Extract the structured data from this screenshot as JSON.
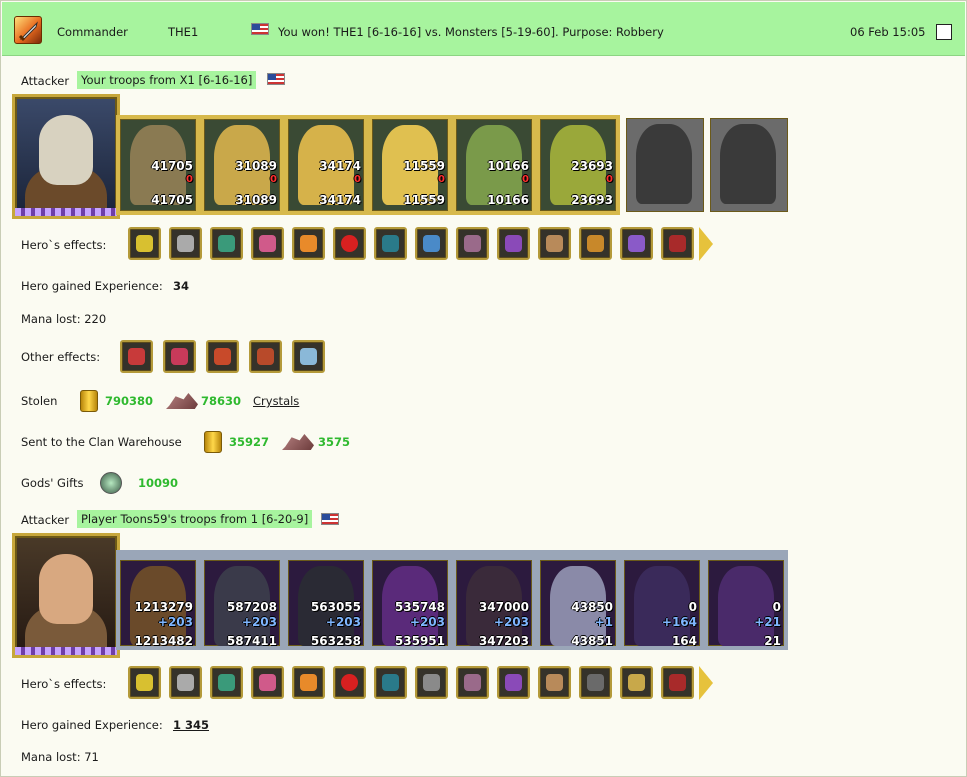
{
  "header": {
    "role": "Commander",
    "player": "THE1",
    "message": "You won! THE1 [6-16-16] vs. Monsters [5-19-60]. Purpose: Robbery",
    "datetime": "06 Feb 15:05"
  },
  "attacker1": {
    "label": "Attacker",
    "tag": "Your troops from X1 [6-16-16]",
    "troops": [
      {
        "top": "41705",
        "loss": "0",
        "bottom": "41705"
      },
      {
        "top": "31089",
        "loss": "0",
        "bottom": "31089"
      },
      {
        "top": "34174",
        "loss": "0",
        "bottom": "34174"
      },
      {
        "top": "11559",
        "loss": "0",
        "bottom": "11559"
      },
      {
        "top": "10166",
        "loss": "0",
        "bottom": "10166"
      },
      {
        "top": "23693",
        "loss": "0",
        "bottom": "23693"
      }
    ],
    "effects_label": "Hero`s effects:",
    "exp_label": "Hero gained Experience:",
    "exp_value": "34",
    "mana_label": "Mana lost: 220",
    "other_label": "Other effects:",
    "stolen_label": "Stolen",
    "stolen_gold": "790380",
    "stolen_ore": "78630",
    "stolen_link": "Crystals",
    "warehouse_label": "Sent to the Clan Warehouse",
    "warehouse_gold": "35927",
    "warehouse_ore": "3575",
    "gods_label": "Gods' Gifts",
    "gods_value": "10090"
  },
  "attacker2": {
    "label": "Attacker",
    "tag": "Player Toons59's troops from 1 [6-20-9]",
    "troops": [
      {
        "top": "1213279",
        "gain": "+203",
        "bottom": "1213482"
      },
      {
        "top": "587208",
        "gain": "+203",
        "bottom": "587411"
      },
      {
        "top": "563055",
        "gain": "+203",
        "bottom": "563258"
      },
      {
        "top": "535748",
        "gain": "+203",
        "bottom": "535951"
      },
      {
        "top": "347000",
        "gain": "+203",
        "bottom": "347203"
      },
      {
        "top": "43850",
        "gain": "+1",
        "bottom": "43851"
      },
      {
        "top": "0",
        "gain": "+164",
        "bottom": "164"
      },
      {
        "top": "0",
        "gain": "+21",
        "bottom": "21"
      }
    ],
    "effects_label": "Hero`s effects:",
    "exp_label": "Hero gained Experience:",
    "exp_value": "1 345",
    "mana_label": "Mana lost: 71"
  },
  "colors": {
    "header_bg": "#a7f49e",
    "green_value": "#2fb92f",
    "loss_red": "#ff3030",
    "gain_blue": "#7fb6ff"
  }
}
